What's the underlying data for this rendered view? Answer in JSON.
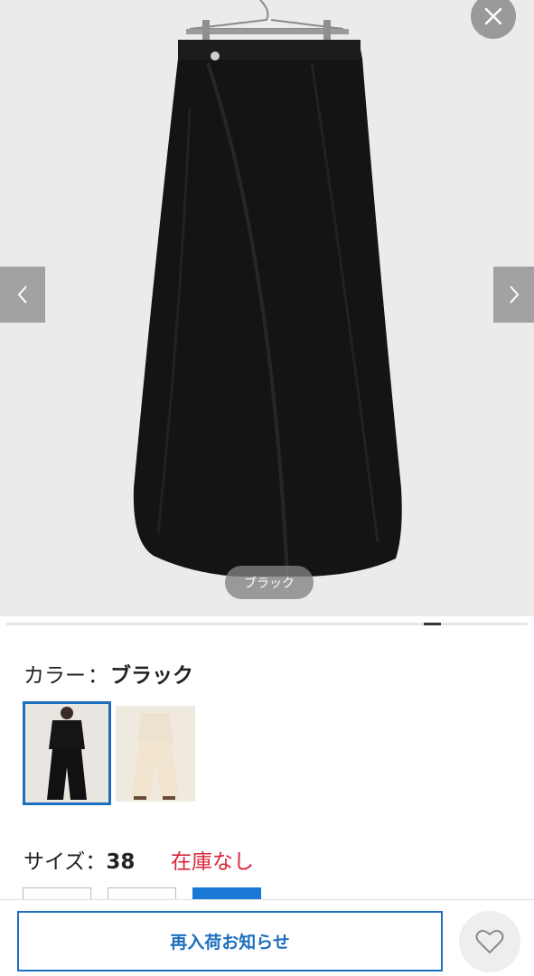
{
  "gallery": {
    "caption": "ブラック",
    "close_icon": "close-icon",
    "prev_icon": "chevron-left-icon",
    "next_icon": "chevron-right-icon"
  },
  "color": {
    "label": "カラー",
    "separator": "：",
    "value": "ブラック",
    "swatches": [
      {
        "name": "black",
        "selected": true
      },
      {
        "name": "beige",
        "selected": false
      }
    ]
  },
  "size": {
    "label": "サイズ",
    "separator": "：",
    "value": "38",
    "stock": "在庫なし",
    "stock_color": "#d7263d"
  },
  "actions": {
    "restock_label": "再入荷お知らせ",
    "favorite_icon": "heart-icon"
  },
  "colors": {
    "accent": "#1d6fbe",
    "size_selected": "#1a78d6"
  }
}
